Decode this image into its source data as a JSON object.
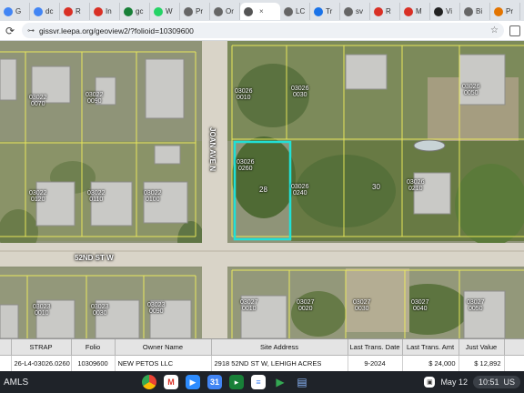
{
  "browser": {
    "tabs": [
      {
        "label": "G",
        "color": "#4285f4"
      },
      {
        "label": "dc",
        "color": "#4285f4"
      },
      {
        "label": "R",
        "color": "#d93025"
      },
      {
        "label": "In",
        "color": "#d93025"
      },
      {
        "label": "gc",
        "color": "#188038"
      },
      {
        "label": "W",
        "color": "#25d366"
      },
      {
        "label": "Pr",
        "color": "#666666"
      },
      {
        "label": "Or",
        "color": "#666666"
      },
      {
        "label": "",
        "color": "#555555",
        "active": true
      },
      {
        "label": "LC",
        "color": "#666666"
      },
      {
        "label": "Tr",
        "color": "#1a73e8"
      },
      {
        "label": "sv",
        "color": "#666666"
      },
      {
        "label": "R",
        "color": "#d93025"
      },
      {
        "label": "M",
        "color": "#d93025"
      },
      {
        "label": "Vi",
        "color": "#222222"
      },
      {
        "label": "Bi",
        "color": "#666666"
      },
      {
        "label": "Pr",
        "color": "#e37400"
      }
    ],
    "close_glyph": "×",
    "new_tab": "+",
    "url": "gissvr.leepa.org/geoview2/?folioid=10309600"
  },
  "map": {
    "parcel_labels": [
      {
        "text": "03022\n0070"
      },
      {
        "text": "03022\n0090"
      },
      {
        "text": "03026\n0010"
      },
      {
        "text": "03026\n0030"
      },
      {
        "text": "03026\n0050"
      },
      {
        "text": "03022\n0120"
      },
      {
        "text": "03022\n0110"
      },
      {
        "text": "03022\n0100"
      },
      {
        "text": "03026\n0260"
      },
      {
        "text": "03026\n0240"
      },
      {
        "text": "03026\n0210"
      },
      {
        "text": "03023\n0010"
      },
      {
        "text": "03023\n0030"
      },
      {
        "text": "03023\n0090"
      },
      {
        "text": "03027\n0010"
      },
      {
        "text": "03027\n0020"
      },
      {
        "text": "03027\n0030"
      },
      {
        "text": "03027\n0040"
      },
      {
        "text": "03027\n0050"
      }
    ],
    "lot_numbers": [
      "28",
      "30"
    ],
    "roads": {
      "vertical": "JOAN AVE N",
      "horizontal": "52ND ST W"
    }
  },
  "results": {
    "columns": [
      "",
      "STRAP",
      "Folio",
      "Owner Name",
      "Site Address",
      "Last Trans. Date",
      "Last Trans. Amt",
      "Just Value",
      "T"
    ],
    "row": [
      "",
      "26-L4-03026.0260",
      "10309600",
      "NEW PETOS LLC",
      "2918 52ND ST W, LEHIGH ACRES",
      "9-2024",
      "$ 24,000",
      "$ 12,892",
      ""
    ]
  },
  "taskbar": {
    "left_text": "AMLS",
    "date": "May 12",
    "time": "10:51",
    "locale": "US"
  },
  "colors": {
    "parcel_line": "#f3f05a",
    "selected_parcel": "#21e0d6",
    "road": "#d9d4c8"
  }
}
